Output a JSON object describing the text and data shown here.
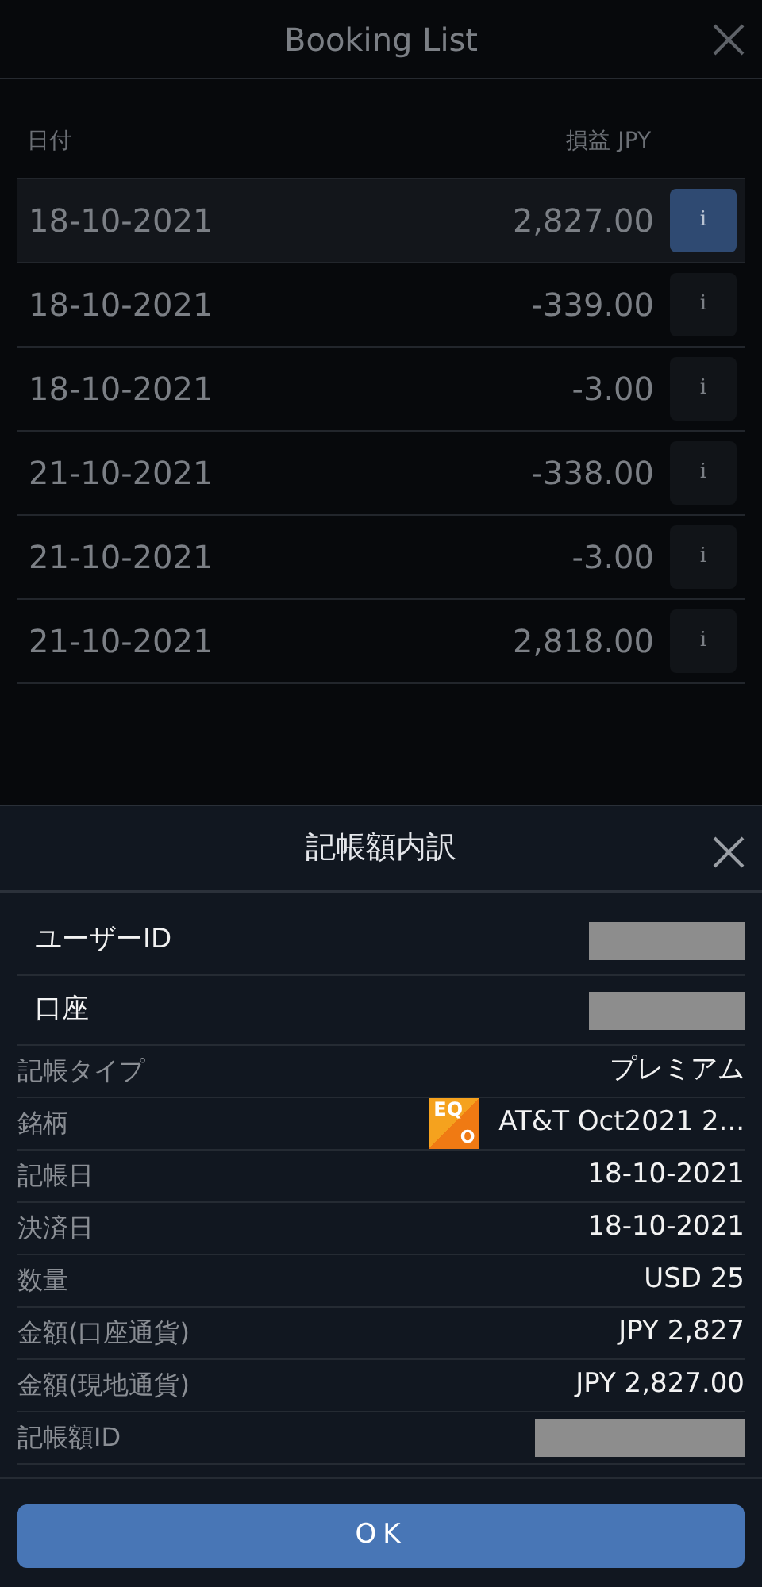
{
  "background": {
    "title": "Booking List",
    "columns": [
      "日付",
      "損益 JPY"
    ],
    "rows": [
      {
        "date": "18-10-2021",
        "amount": "2,827.00",
        "info": "i",
        "selected": true
      },
      {
        "date": "18-10-2021",
        "amount": "-339.00",
        "info": "i",
        "selected": false
      },
      {
        "date": "18-10-2021",
        "amount": "-3.00",
        "info": "i",
        "selected": false
      },
      {
        "date": "21-10-2021",
        "amount": "-338.00",
        "info": "i",
        "selected": false
      },
      {
        "date": "21-10-2021",
        "amount": "-3.00",
        "info": "i",
        "selected": false
      },
      {
        "date": "21-10-2021",
        "amount": "2,818.00",
        "info": "i",
        "selected": false
      }
    ]
  },
  "sheet": {
    "title": "記帳額内訳",
    "fields": [
      {
        "label": "ユーザーID",
        "kind": "redacted",
        "prominent": true
      },
      {
        "label": "口座",
        "kind": "redacted",
        "prominent": true
      },
      {
        "label": "記帳タイプ",
        "kind": "text",
        "value": "プレミアム",
        "prominent": false
      },
      {
        "label": "銘柄",
        "kind": "instrument",
        "badge": "EQ",
        "badge_sub": "O",
        "value": "AT&T Oct2021 2...",
        "prominent": false
      },
      {
        "label": "記帳日",
        "kind": "text",
        "value": "18-10-2021",
        "prominent": false
      },
      {
        "label": "決済日",
        "kind": "text",
        "value": "18-10-2021",
        "prominent": false
      },
      {
        "label": "数量",
        "kind": "text",
        "value": "USD 25",
        "prominent": false
      },
      {
        "label": "金額(口座通貨)",
        "kind": "text",
        "value": "JPY 2,827",
        "prominent": false
      },
      {
        "label": "金額(現地通貨)",
        "kind": "text",
        "value": "JPY 2,827.00",
        "prominent": false
      },
      {
        "label": "記帳額ID",
        "kind": "redacted-wide",
        "prominent": false
      }
    ],
    "button": "OK"
  }
}
